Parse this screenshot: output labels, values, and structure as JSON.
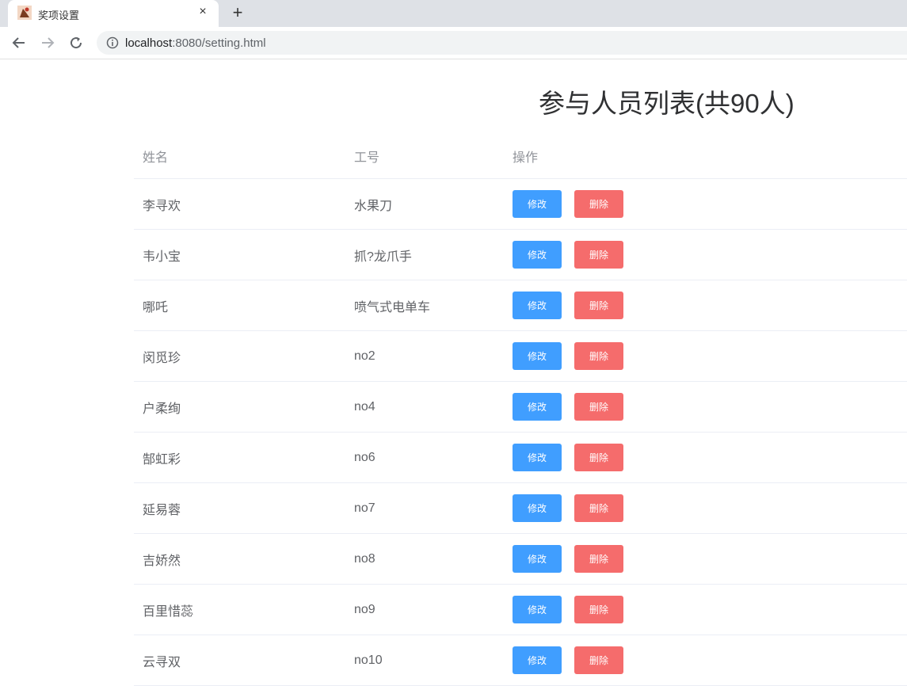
{
  "browser": {
    "tab_title": "奖项设置",
    "tab_close": "×",
    "new_tab": "+",
    "url_host": "localhost",
    "url_rest": ":8080/setting.html"
  },
  "page": {
    "title": "参与人员列表(共90人)",
    "columns": [
      "姓名",
      "工号",
      "操作"
    ],
    "edit_label": "修改",
    "delete_label": "删除",
    "rows": [
      {
        "name": "李寻欢",
        "id": "水果刀"
      },
      {
        "name": "韦小宝",
        "id": "抓?龙爪手"
      },
      {
        "name": "哪吒",
        "id": "喷气式电单车"
      },
      {
        "name": "闵觅珍",
        "id": "no2"
      },
      {
        "name": "户柔绚",
        "id": "no4"
      },
      {
        "name": "郜虹彩",
        "id": "no6"
      },
      {
        "name": "延易蓉",
        "id": "no7"
      },
      {
        "name": "吉娇然",
        "id": "no8"
      },
      {
        "name": "百里惜蕊",
        "id": "no9"
      },
      {
        "name": "云寻双",
        "id": "no10"
      }
    ]
  },
  "colors": {
    "edit": "#409eff",
    "delete": "#f56c6c",
    "title": "#303133",
    "header_text": "#909399",
    "cell_text": "#606266"
  },
  "icons": [
    "favicon-icon",
    "close-icon",
    "plus-icon",
    "back-arrow-icon",
    "forward-arrow-icon",
    "reload-icon",
    "info-icon"
  ]
}
